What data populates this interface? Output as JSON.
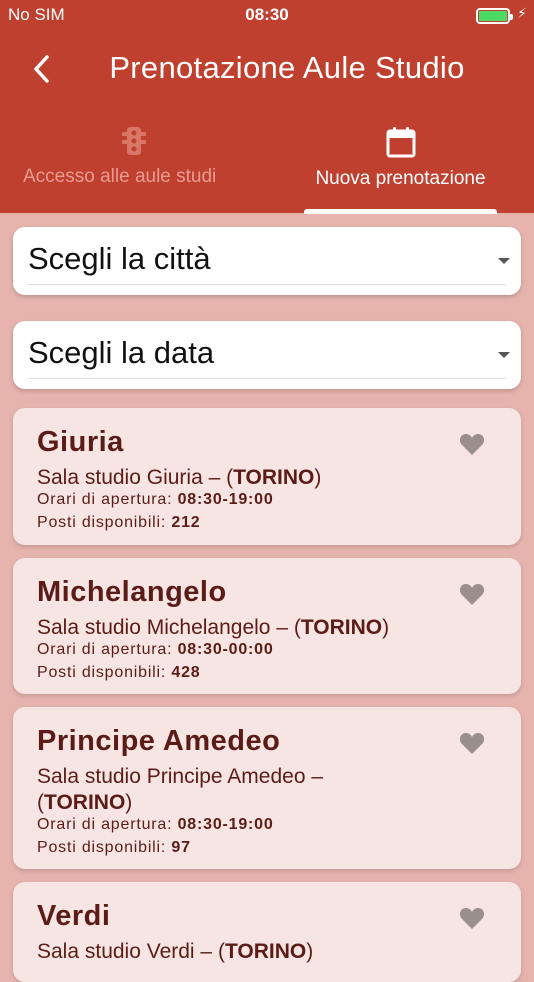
{
  "status": {
    "carrier": "No SIM",
    "time": "08:30",
    "battery_level": 1.0,
    "battery_color": "#4cd964"
  },
  "header": {
    "title": "Prenotazione Aule Studio",
    "tabs": [
      {
        "label": "Accesso alle aule studi",
        "icon": "traffic-light-icon",
        "active": false
      },
      {
        "label": "Nuova prenotazione",
        "icon": "calendar-icon",
        "active": true
      }
    ],
    "color": "#c0402f"
  },
  "filters": {
    "city_label": "Scegli la città",
    "date_label": "Scegli la data"
  },
  "rooms": [
    {
      "name": "Giuria",
      "desc_prefix": "Sala studio Giuria – (",
      "city": "TORINO",
      "desc_suffix": ")",
      "hours_label": "Orari di apertura:",
      "hours": "08:30-19:00",
      "seats_label": "Posti disponibili:",
      "seats": "212"
    },
    {
      "name": "Michelangelo",
      "desc_prefix": "Sala studio Michelangelo – (",
      "city": "TORINO",
      "desc_suffix": ")",
      "hours_label": "Orari di apertura:",
      "hours": "08:30-00:00",
      "seats_label": "Posti disponibili:",
      "seats": "428"
    },
    {
      "name": "Principe Amedeo",
      "desc_prefix": "Sala studio Principe Amedeo – (",
      "city": "TORINO",
      "desc_suffix": ")",
      "hours_label": "Orari di apertura:",
      "hours": "08:30-19:00",
      "seats_label": "Posti disponibili:",
      "seats": "97"
    },
    {
      "name": "Verdi",
      "desc_prefix": "Sala studio Verdi – (",
      "city": "TORINO",
      "desc_suffix": ")"
    }
  ]
}
